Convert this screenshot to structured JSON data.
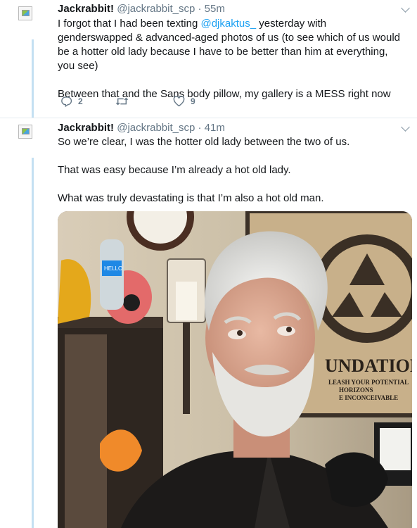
{
  "tweet1": {
    "name": "Jackrabbit!",
    "handle": "@jackrabbit_scp",
    "separator": "·",
    "time": "55m",
    "text_part1": "I forgot that I had been texting ",
    "mention": "@djkaktus_",
    "text_part2": " yesterday with genderswapped & advanced-aged photos of us (to see which of us would be a hotter old lady because I have to be better than him at everything, you see)",
    "paragraph2": "Between that and the Sans body pillow, my gallery is a MESS right now",
    "replies": "2",
    "likes": "9"
  },
  "tweet2": {
    "name": "Jackrabbit!",
    "handle": "@jackrabbit_scp",
    "separator": "·",
    "time": "41m",
    "paragraph1": "So we’re clear, I was the hotter old lady between the two of us.",
    "paragraph2": "That was easy because I’m already a hot old lady.",
    "paragraph3": "What was truly devastating is that I’m also a hot old man."
  },
  "photo": {
    "poster_text_1": "UNDATION",
    "poster_text_2": "LEASH YOUR POTENTIAL",
    "poster_text_3": "HORIZONS",
    "poster_text_4": "E INCONCEIVABLE",
    "bottle_label": "HELLO"
  },
  "colors": {
    "link": "#1da1f2",
    "thread_line": "#c4e0f2",
    "secondary_text": "#657786"
  }
}
